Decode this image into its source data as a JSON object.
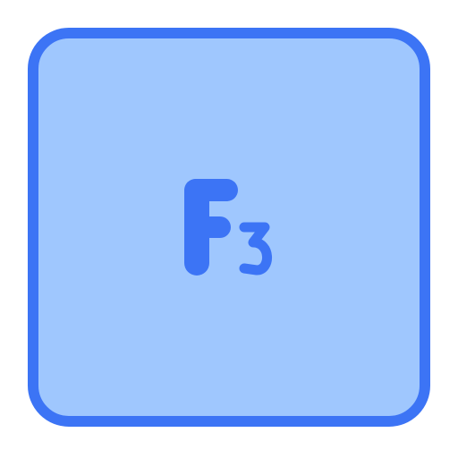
{
  "icon": {
    "name": "f3-key-icon",
    "letter": "F",
    "digit": "3",
    "colors": {
      "fill": "#9fc7fe",
      "stroke": "#3c74f5",
      "glyph": "#3c74f5",
      "background": "#ffffff"
    }
  }
}
